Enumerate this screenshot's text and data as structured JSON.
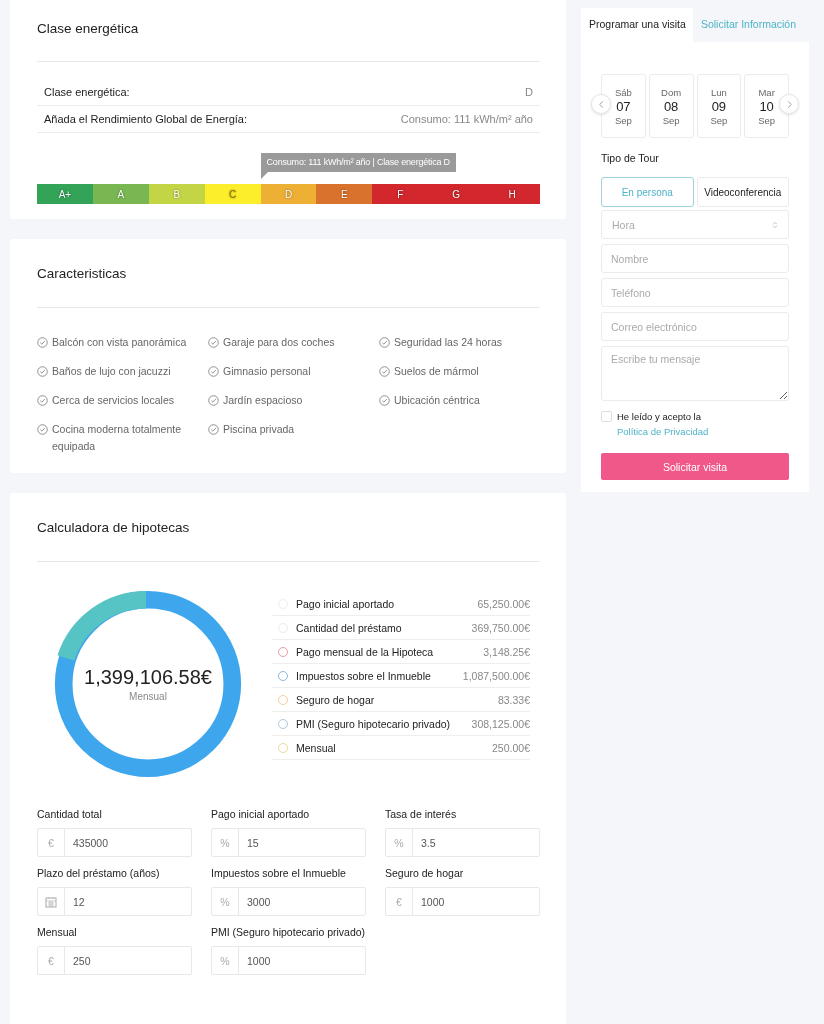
{
  "energy": {
    "title": "Clase energética",
    "rows": [
      {
        "label": "Clase energética:",
        "value": "D"
      },
      {
        "label": "Añada el Rendimiento Global de Energía:",
        "value": "Consumo: 111 kWh/m² año"
      }
    ],
    "tooltip": "Consumo: 111 kWh/m² año | Clase energética D",
    "scale": [
      {
        "label": "A+",
        "color": "#33a357",
        "selected": false
      },
      {
        "label": "A",
        "color": "#79b752",
        "selected": false
      },
      {
        "label": "B",
        "color": "#c3d545",
        "selected": false
      },
      {
        "label": "C",
        "color": "#fcee2a",
        "selected": false
      },
      {
        "label": "D",
        "color": "#edb034",
        "selected": true
      },
      {
        "label": "E",
        "color": "#d8722c",
        "selected": false
      },
      {
        "label": "F",
        "color": "#d2272c",
        "selected": false
      },
      {
        "label": "G",
        "color": "#d2272d",
        "selected": false
      },
      {
        "label": "H",
        "color": "#d2272e",
        "selected": false
      }
    ]
  },
  "features": {
    "title": "Caracteristicas",
    "items": [
      "Balcón con vista panorámica",
      "Garaje para dos coches",
      "Seguridad las 24 horas",
      "Baños de lujo con jacuzzi",
      "Gimnasio personal",
      "Suelos de mármol",
      "Cerca de servicios locales",
      "Jardín espacioso",
      "Ubicación céntrica",
      "Cocina moderna totalmente equipada",
      "Piscina privada"
    ]
  },
  "mortgage": {
    "title": "Calculadora de hipotecas",
    "total": "1,399,106.58€",
    "total_caption": "Mensual",
    "legend": [
      {
        "label": "Pago inicial aportado",
        "value": "65,250.00€",
        "color": "#eeeeee"
      },
      {
        "label": "Cantidad del préstamo",
        "value": "369,750.00€",
        "color": "#ececec"
      },
      {
        "label": "Pago mensual de la Hipoteca",
        "value": "3,148.25€",
        "color": "#ee9aa4"
      },
      {
        "label": "Impuestos sobre el Inmueble",
        "value": "1,087,500.00€",
        "color": "#8eb6de"
      },
      {
        "label": "Seguro de hogar",
        "value": "83.33€",
        "color": "#f4cfa0"
      },
      {
        "label": "PMI (Seguro hipotecario privado)",
        "value": "308,125.00€",
        "color": "#a6cadf"
      },
      {
        "label": "Mensual",
        "value": "250.00€",
        "color": "#eedb96"
      }
    ],
    "fields": [
      {
        "label": "Cantidad total",
        "kind": "text",
        "unit": "€",
        "value": "435000"
      },
      {
        "label": "Pago inicial aportado",
        "kind": "text",
        "unit": "%",
        "value": "15"
      },
      {
        "label": "Tasa de interés",
        "kind": "text",
        "unit": "%",
        "value": "3.5"
      },
      {
        "label": "Plazo del préstamo (años)",
        "kind": "calendar",
        "value": "12"
      },
      {
        "label": "Impuestos sobre el Inmueble",
        "kind": "text",
        "unit": "%",
        "value": "3000"
      },
      {
        "label": "Seguro de hogar",
        "kind": "text",
        "unit": "€",
        "value": "1000"
      },
      {
        "label": "Mensual",
        "kind": "text",
        "unit": "€",
        "value": "250"
      },
      {
        "label": "PMI (Seguro hipotecario privado)",
        "kind": "text",
        "unit": "%",
        "value": "1000"
      }
    ]
  },
  "visit": {
    "tabs": [
      {
        "label": "Programar una visita",
        "selected": true
      },
      {
        "label": "Solicitar Información",
        "selected": false
      }
    ],
    "dates": [
      {
        "weekday": "Sáb",
        "day": "07",
        "month": "Sep"
      },
      {
        "weekday": "Dom",
        "day": "08",
        "month": "Sep"
      },
      {
        "weekday": "Lun",
        "day": "09",
        "month": "Sep"
      },
      {
        "weekday": "Mar",
        "day": "10",
        "month": "Sep"
      }
    ],
    "tour_label": "Tipo de Tour",
    "tour_options": [
      {
        "label": "En persona",
        "selected": true
      },
      {
        "label": "Videoconferencia",
        "selected": false
      }
    ],
    "fields": [
      {
        "kind": "select",
        "placeholder": "Hora"
      },
      {
        "kind": "text",
        "placeholder": "Nombre"
      },
      {
        "kind": "text",
        "placeholder": "Teléfono"
      },
      {
        "kind": "text",
        "placeholder": "Correo electrónico"
      },
      {
        "kind": "textarea",
        "placeholder": "Escribe tu mensaje"
      }
    ],
    "consent": {
      "checked": false,
      "text": "He leído y acepto la",
      "link": "Política de Privacidad"
    },
    "submit": "Solicitar visita"
  }
}
